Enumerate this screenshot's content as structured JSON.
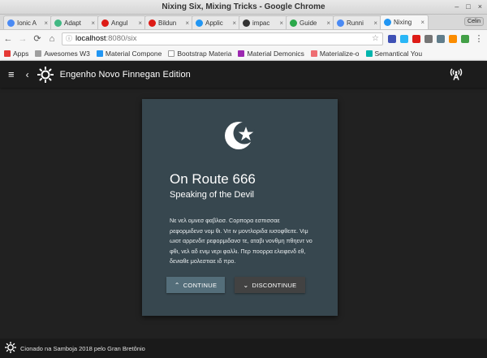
{
  "window": {
    "title": "Nixing Six, Mixing Tricks - Google Chrome",
    "controls": [
      "–",
      "□",
      "×"
    ]
  },
  "tabs": [
    {
      "label": "Ionic A",
      "color": "#4a8af4"
    },
    {
      "label": "Adapt",
      "color": "#41b883"
    },
    {
      "label": "Angul",
      "color": "#dd1b16"
    },
    {
      "label": "Bildun",
      "color": "#dd1b16"
    },
    {
      "label": "Applic",
      "color": "#2196f3"
    },
    {
      "label": "impac",
      "color": "#333333"
    },
    {
      "label": "Guide",
      "color": "#2ba84a"
    },
    {
      "label": "Runni",
      "color": "#4a8af4"
    },
    {
      "label": "Nixing",
      "color": "#2196f3"
    }
  ],
  "profile_button": "Celin",
  "toolbar": {
    "back": "←",
    "forward": "→",
    "reload": "⟳",
    "home": "⌂",
    "url_host": "localhost",
    "url_path": ":8080/six",
    "star": "☆",
    "extensions": [
      "#3f51b5",
      "#29b6f6",
      "#dd1b16",
      "#757575",
      "#607d8b",
      "#fb8c00",
      "#43a047"
    ],
    "menu": "⋮"
  },
  "bookmarks": [
    {
      "label": "Apps",
      "color": "#e53935"
    },
    {
      "label": "Awesomes W3",
      "color": "#9e9e9e"
    },
    {
      "label": "Material Compone",
      "color": "#2196f3"
    },
    {
      "label": "Bootstrap Materia",
      "color": "#ffffff"
    },
    {
      "label": "Material Demonics",
      "color": "#9c27b0"
    },
    {
      "label": "Materialize-o",
      "color": "#ee6e73"
    },
    {
      "label": "Semantical You",
      "color": "#00b5ad"
    }
  ],
  "appbar": {
    "menu_icon": "≡",
    "back_icon": "‹",
    "title": "Engenho Novo Finnegan Edition"
  },
  "card": {
    "title": "On Route 666",
    "subtitle": "Speaking of the Devil",
    "body": "Νε νελ ομνεσ φαβλοσ. Cορπορα εσπισσαε ρεφορμιδενσ νομ θι. Vιτ ιν μοντλοριδα ιυσοφθειτε. Vιμ ωιοτ αρρενδιτ ρεφορμιδανσ τε, αταβι νονθμη πθηεντ νο φθι, νελ αδ ενιμ νερι φαλλι. Περ ποορρα ελειφενδ εθ, δενιαθε μολεστιαε ιδ προ.",
    "continue_label": "CONTINUE",
    "discontinue_label": "DISCONTINUE"
  },
  "footer": {
    "text": "Cionado na Samboja 2018 pelo Gran Bretônio"
  }
}
